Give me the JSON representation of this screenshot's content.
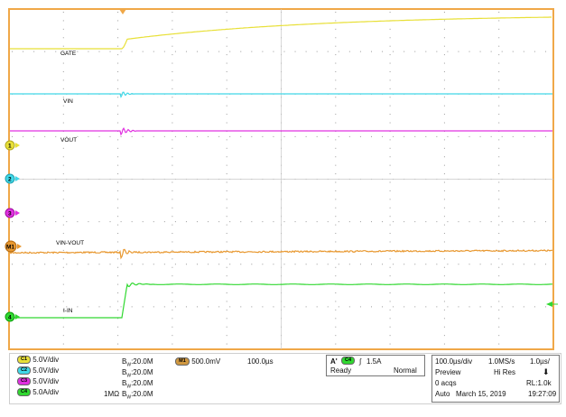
{
  "colors": {
    "grid_frame": "#f0a848",
    "gate": "#e8e038",
    "vin": "#40d8e8",
    "vout": "#e030e0",
    "vin_vout": "#e89830",
    "i_in": "#30d830"
  },
  "trace_labels": {
    "gate": "GATE",
    "vin": "VIN",
    "vout": "VOUT",
    "vin_vout": "VIN-VOUT",
    "i_in": "I-IN"
  },
  "markers": {
    "ch1": "1",
    "ch2": "2",
    "ch3": "3",
    "math1": "M1",
    "ch4": "4"
  },
  "channels": [
    {
      "badge": "C1",
      "scale": "5.0V/div",
      "impedance": "",
      "bw_prefix": "B",
      "bw_sub": "W",
      "bw_value": ":20.0M",
      "color": "#e8e038"
    },
    {
      "badge": "C2",
      "scale": "5.0V/div",
      "impedance": "",
      "bw_prefix": "B",
      "bw_sub": "W",
      "bw_value": ":20.0M",
      "color": "#40d8e8"
    },
    {
      "badge": "C3",
      "scale": "5.0V/div",
      "impedance": "",
      "bw_prefix": "B",
      "bw_sub": "W",
      "bw_value": ":20.0M",
      "color": "#e030e0"
    },
    {
      "badge": "C4",
      "scale": "5.0A/div",
      "impedance": "1MΩ",
      "bw_prefix": "B",
      "bw_sub": "W",
      "bw_value": ":20.0M",
      "color": "#30d830"
    }
  ],
  "math": {
    "badge": "M1",
    "scale": "500.0mV",
    "time": "100.0µs",
    "color": "#d09840"
  },
  "trigger": {
    "prefix": "A'",
    "badge": "C4",
    "slope": "∫",
    "level": "1.5A",
    "state": "Ready",
    "mode": "Normal"
  },
  "acquisition": {
    "timebase": "100.0µs/div",
    "sample_rate": "1.0MS/s",
    "resolution": "1.0µs/",
    "preview": "Preview",
    "mode": "Hi Res",
    "arrow": "⬇",
    "acqs": "0 acqs",
    "record_length": "RL:1.0k",
    "auto": "Auto",
    "date": "March 15, 2019",
    "time": "19:27:09"
  }
}
